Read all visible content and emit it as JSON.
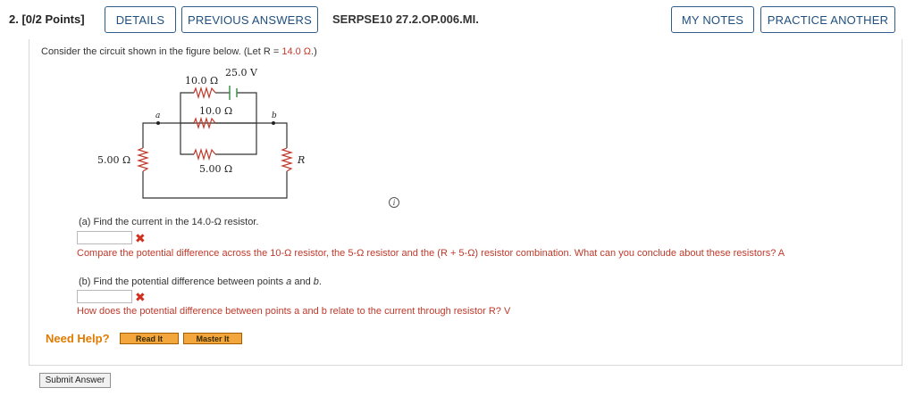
{
  "header": {
    "question_label": "2. [0/2 Points]",
    "details_label": "DETAILS",
    "previous_answers_label": "PREVIOUS ANSWERS",
    "question_code": "SERPSE10 27.2.OP.006.MI.",
    "my_notes_label": "MY NOTES",
    "practice_another_label": "PRACTICE ANOTHER"
  },
  "prompt": {
    "before": "Consider the circuit shown in the figure below. (Let R = ",
    "r_value": "14.0 Ω",
    "after": ".)"
  },
  "circuit": {
    "battery_label": "25.0 V",
    "resistor_top_label": "10.0 Ω",
    "resistor_middle_label": "10.0 Ω",
    "resistor_bottom_label": "5.00 Ω",
    "resistor_left_label": "5.00 Ω",
    "resistor_right_label": "R",
    "point_a": "a",
    "point_b": "b"
  },
  "part_a": {
    "question": "(a) Find the current in the 14.0-Ω resistor.",
    "answer_value": "",
    "feedback": "Compare the potential difference across the 10-Ω resistor, the 5-Ω resistor and the (R + 5-Ω) resistor combination. What can you conclude about these resistors? A"
  },
  "part_b": {
    "question_before": "(b) Find the potential difference between points ",
    "point_a": "a",
    "and_word": " and ",
    "point_b": "b",
    "period": ".",
    "answer_value": "",
    "feedback": "How does the potential difference between points a and b relate to the current through resistor R? V"
  },
  "help": {
    "label": "Need Help?",
    "read_it": "Read It",
    "master_it": "Master It"
  },
  "submit_label": "Submit Answer",
  "icons": {
    "info": "i",
    "wrong": "✖"
  },
  "colors": {
    "button_border": "#2f5d8a",
    "error_red": "#c0392b",
    "help_orange": "#e07b00",
    "help_button": "#f2a63c"
  }
}
